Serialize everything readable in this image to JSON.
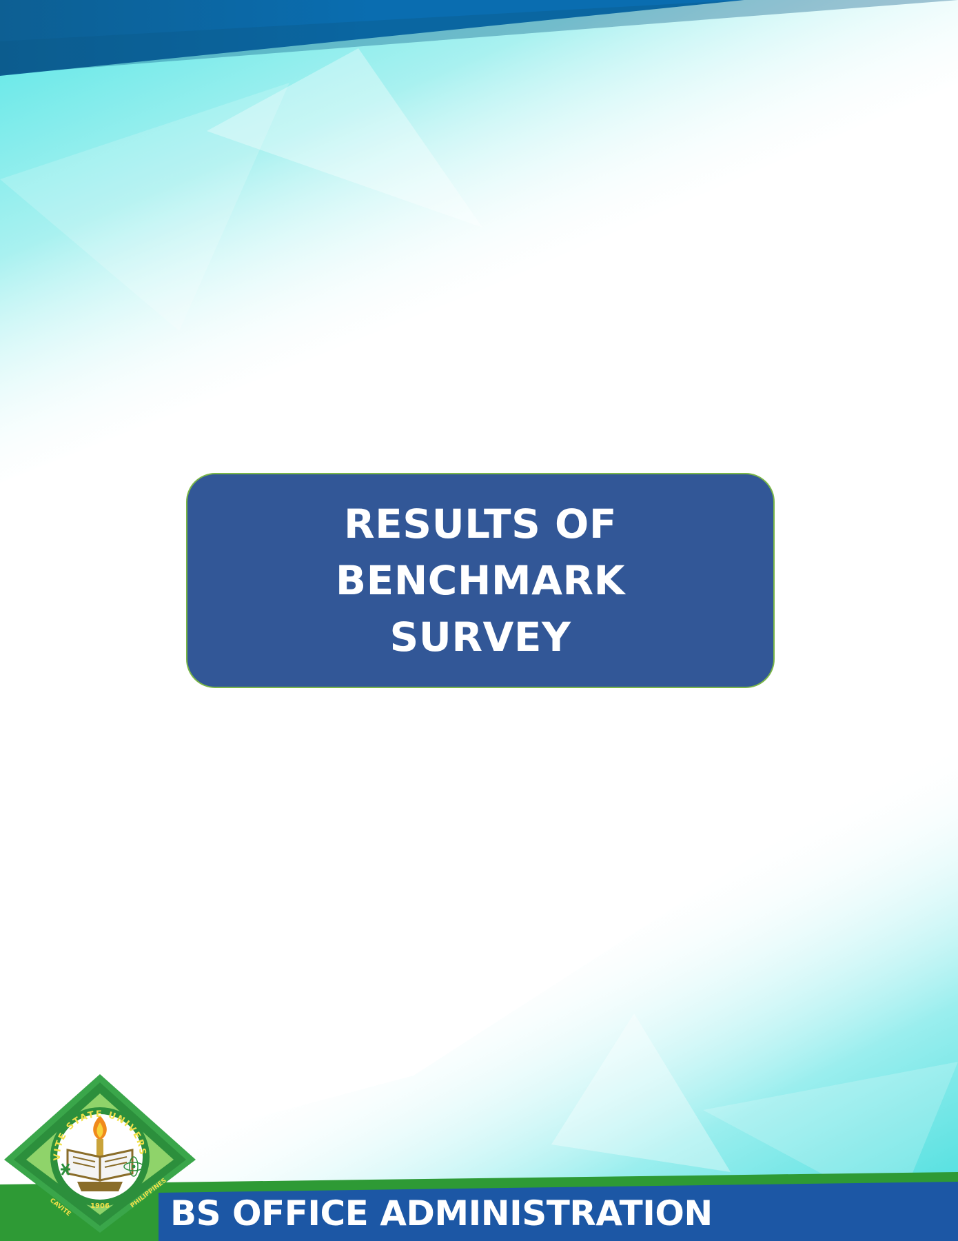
{
  "document": {
    "title_lines": [
      "RESULTS OF BENCHMARK",
      "SURVEY"
    ],
    "footer_title": "BS OFFICE ADMINISTRATION"
  },
  "seal": {
    "icon": "university-seal-icon",
    "ring_text_top": "CAVITE STATE UNIVERSITY",
    "ring_text_bottom": "CAVITE PHILIPPINES",
    "year": "1906"
  },
  "colors": {
    "title_box": "#325797",
    "title_box_border": "#7ab648",
    "header_band": "#0b6aa8",
    "footer_green": "#2e9a35",
    "footer_blue": "#1c57a5",
    "aqua": "#4fe0e0"
  }
}
